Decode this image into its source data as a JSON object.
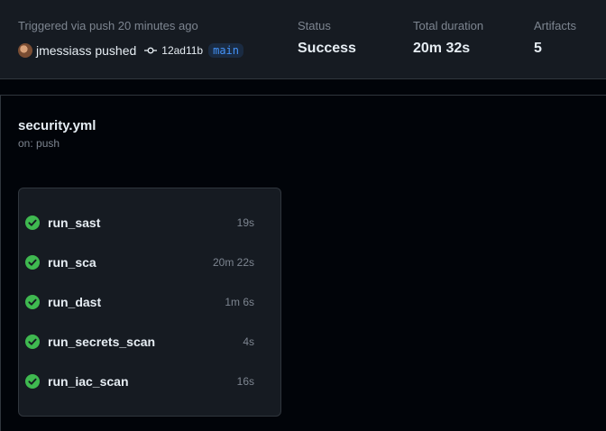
{
  "summary": {
    "trigger_text": "Triggered via push 20 minutes ago",
    "actor": "jmessiass pushed",
    "commit_sha": "12ad11b",
    "branch": "main",
    "status_label": "Status",
    "status_value": "Success",
    "duration_label": "Total duration",
    "duration_value": "20m 32s",
    "artifacts_label": "Artifacts",
    "artifacts_value": "5"
  },
  "workflow": {
    "file": "security.yml",
    "trigger": "on: push",
    "jobs": [
      {
        "name": "run_sast",
        "duration": "19s",
        "status": "success"
      },
      {
        "name": "run_sca",
        "duration": "20m 22s",
        "status": "success"
      },
      {
        "name": "run_dast",
        "duration": "1m 6s",
        "status": "success"
      },
      {
        "name": "run_secrets_scan",
        "duration": "4s",
        "status": "success"
      },
      {
        "name": "run_iac_scan",
        "duration": "16s",
        "status": "success"
      }
    ]
  },
  "icons": {
    "commit": "git-commit-icon",
    "job_status": "check-circle-fill-icon",
    "avatar": "user-avatar"
  },
  "colors": {
    "success": "#3fb950",
    "link": "#4493f8",
    "text": "#e6edf3",
    "muted": "#7d8590"
  }
}
